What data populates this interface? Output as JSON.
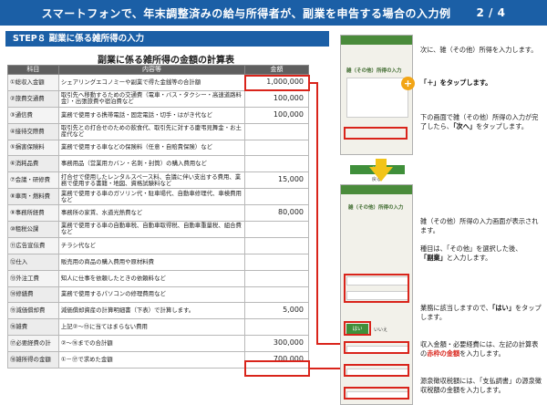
{
  "banner": {
    "title": "スマートフォンで、年末調整済みの給与所得者が、副業を申告する場合の入力例",
    "page": "2 / 4"
  },
  "step": {
    "label": "STEP８  副業に係る雑所得の入力"
  },
  "table": {
    "title": "副業に係る雑所得の金額の計算表",
    "headers": [
      "科目",
      "内容等",
      "金額"
    ],
    "rows": [
      {
        "item": "①総収入金額",
        "desc": "シェアリングエコノミーや副業で得た金銭等の合計額",
        "amount": "1,000,000"
      },
      {
        "item": "②旅費交通費",
        "desc": "取引先へ移動するための交通費（電車・バス・タクシー・高速道路料金）・出張旅費や宿泊費など",
        "amount": "100,000"
      },
      {
        "item": "③通信費",
        "desc": "業務で使用する携帯電話・固定電話・切手・はがき代など",
        "amount": "100,000"
      },
      {
        "item": "④接待交際費",
        "desc": "取引先との打合せのための飲食代、取引先に対する慶弔見舞金・お土産代など",
        "amount": ""
      },
      {
        "item": "⑤損害保険料",
        "desc": "業務で使用する車などの保険料（任意・自賠責保険）など",
        "amount": ""
      },
      {
        "item": "⑥消耗品費",
        "desc": "事務用品（営業用カバン・名刺・封筒）の購入費用など",
        "amount": ""
      },
      {
        "item": "⑦会議・研修費",
        "desc": "打合せで使用したレンタルスペース料、会議に伴い支出する費用、業務で使用する書籍・地図、資格試験料など",
        "amount": "15,000"
      },
      {
        "item": "⑧車両・燃料費",
        "desc": "業務で使用する車のガソリン代・駐車場代、自動車修理代、車検費用など",
        "amount": ""
      },
      {
        "item": "⑨事務所経費",
        "desc": "事務所の家賃、水道光熱費など",
        "amount": "80,000"
      },
      {
        "item": "⑩租税公課",
        "desc": "業務で使用する車の自動車税、自動車取得税、自動車重量税、組合費など",
        "amount": ""
      },
      {
        "item": "⑪広告宣伝費",
        "desc": "チラシ代など",
        "amount": ""
      },
      {
        "item": "⑫仕入",
        "desc": "販売用の商品の購入費用や原材料費",
        "amount": ""
      },
      {
        "item": "⑬外注工費",
        "desc": "知人に仕事を依頼したときの依頼料など",
        "amount": ""
      },
      {
        "item": "⑭修繕費",
        "desc": "業務で使用するパソコンの修理費用など",
        "amount": ""
      },
      {
        "item": "⑮減価償却費",
        "desc": "減価償却資産の計算明細書（下表）で計算します。",
        "amount": "5,000"
      },
      {
        "item": "⑯雑費",
        "desc": "上記②～⑮に当てはまらない費用",
        "amount": ""
      },
      {
        "item": "⑰必要経費の計",
        "desc": "②～⑯までの合計額",
        "amount": "300,000"
      },
      {
        "item": "⑱雑所得の金額",
        "desc": "①－⑰で求めた金額",
        "amount": "700,000"
      }
    ]
  },
  "phone1": {
    "heading": "雑（その他）所得の入力",
    "back_btn": "戻る",
    "next_btn": "次へ"
  },
  "phone2": {
    "heading": "雑（その他）所得の入力",
    "yes_btn": "はい",
    "no_btn": "いいえ"
  },
  "notes": {
    "n1": "次に、雑（その他）所得を入力します。",
    "n2": "「＋」をタップします。",
    "n3a": "下の画面で雑（その他）所得の入力が完了したら、",
    "n3b": "「次へ」",
    "n3c": "をタップします。",
    "n4": "雑（その他）所得の入力画面が表示されます。",
    "n5a": "種目は、「その他」を選択した後、",
    "n5b": "「副業」",
    "n5c": "と入力します。",
    "n6a": "業務に該当しますので、",
    "n6b": "「はい」",
    "n6c": "をタップします。",
    "n7a": "収入金額・必要経費には、左記の計算表の",
    "n7b": "赤枠の金額",
    "n7c": "を入力します。",
    "n8": "源泉徴収税額には、「支払調書」の源泉徴収税額の金額を入力します。"
  },
  "colors": {
    "banner": "#1b5fa6",
    "highlight": "#d9241b",
    "phone_green": "#4a8b3b",
    "arrow": "#f2c418"
  }
}
